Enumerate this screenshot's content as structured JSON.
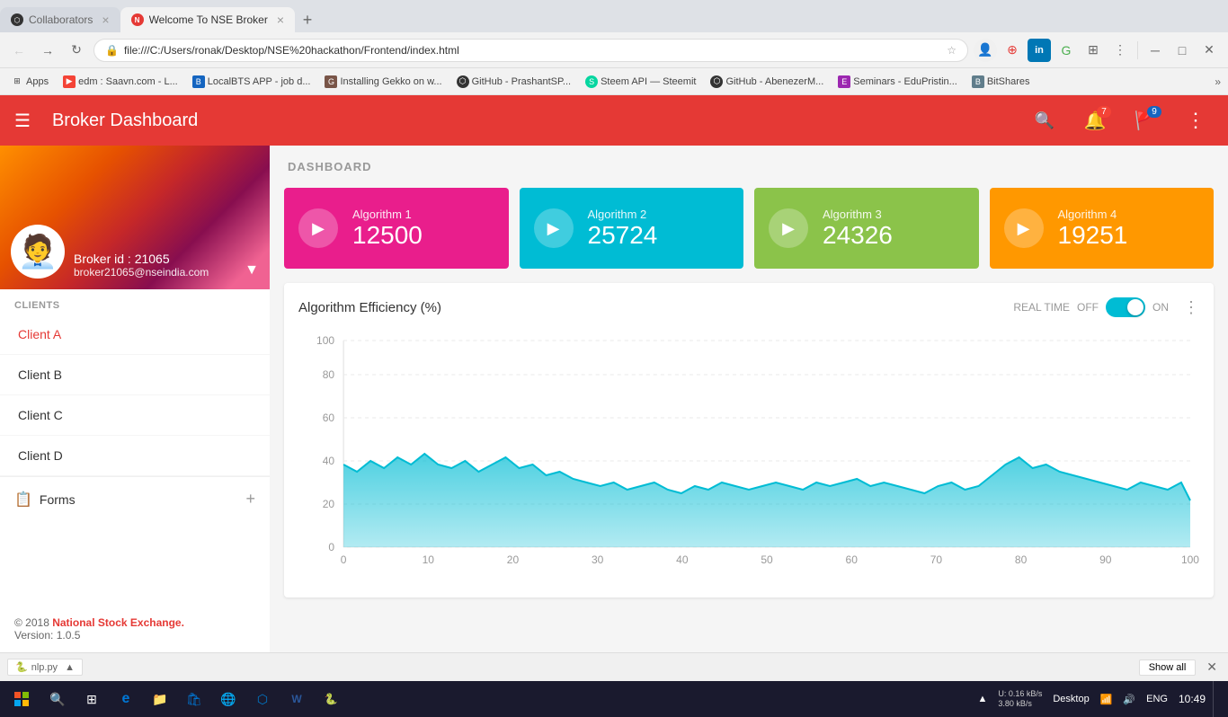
{
  "browser": {
    "tabs": [
      {
        "id": "tab1",
        "icon": "github",
        "label": "Collaborators",
        "active": false
      },
      {
        "id": "tab2",
        "icon": "nse",
        "label": "Welcome To NSE Broker",
        "active": true
      }
    ],
    "address": "file:///C:/Users/ronak/Desktop/NSE%20hackathon/Frontend/index.html",
    "bookmarks": [
      {
        "id": "apps",
        "label": "Apps",
        "icon": "⊞"
      },
      {
        "id": "edm",
        "label": "edm : Saavn.com - L...",
        "icon": "▶"
      },
      {
        "id": "local",
        "label": "LocalBTS APP - job d...",
        "icon": "📋"
      },
      {
        "id": "gekko",
        "label": "Installing Gekko on w...",
        "icon": "📄"
      },
      {
        "id": "github1",
        "label": "GitHub - PrashantSP...",
        "icon": "⚪"
      },
      {
        "id": "steem",
        "label": "Steem API — Steemit",
        "icon": "🔵"
      },
      {
        "id": "github2",
        "label": "GitHub - AbenezerM...",
        "icon": "⚪"
      },
      {
        "id": "seminars",
        "label": "Seminars - EduPristin...",
        "icon": "📄"
      },
      {
        "id": "bitshares",
        "label": "BitShares",
        "icon": "◈"
      }
    ]
  },
  "app": {
    "title": "Broker Dashboard",
    "nav_badges": {
      "bell": "7",
      "flag": "9"
    }
  },
  "sidebar": {
    "user": {
      "id": "Broker id : 21065",
      "email": "broker21065@nseindia.com"
    },
    "section_label": "Clients",
    "clients": [
      {
        "id": "client-a",
        "label": "Client A",
        "active": true
      },
      {
        "id": "client-b",
        "label": "Client B",
        "active": false
      },
      {
        "id": "client-c",
        "label": "Client C",
        "active": false
      },
      {
        "id": "client-d",
        "label": "Client D",
        "active": false
      }
    ],
    "forms_label": "Forms",
    "footer": {
      "copyright": "© 2018 ",
      "brand": "National Stock Exchange.",
      "version": "Version: 1.0.5"
    }
  },
  "dashboard": {
    "header": "DASHBOARD",
    "algorithms": [
      {
        "id": "algo1",
        "name": "Algorithm 1",
        "value": "12500",
        "color": "#e91e8c"
      },
      {
        "id": "algo2",
        "name": "Algorithm 2",
        "value": "25724",
        "color": "#00bcd4"
      },
      {
        "id": "algo3",
        "name": "Algorithm 3",
        "value": "24326",
        "color": "#8bc34a"
      },
      {
        "id": "algo4",
        "name": "Algorithm 4",
        "value": "19251",
        "color": "#ff9800"
      }
    ],
    "chart": {
      "title": "Algorithm Efficiency (%)",
      "realtime_label": "REAL TIME",
      "off_label": "OFF",
      "on_label": "ON",
      "y_axis": [
        0,
        20,
        40,
        60,
        80,
        100
      ],
      "x_axis": [
        0,
        10,
        20,
        30,
        40,
        50,
        60,
        70,
        80,
        90,
        100
      ]
    }
  },
  "bottom_bar": {
    "file_name": "nlp.py",
    "show_all": "Show all"
  },
  "taskbar": {
    "time": "10:49",
    "date": "",
    "network_up": "U: 0.16 kB/s",
    "network_down": "3.80 kB/s",
    "locale": "ENG",
    "desktop": "Desktop"
  }
}
